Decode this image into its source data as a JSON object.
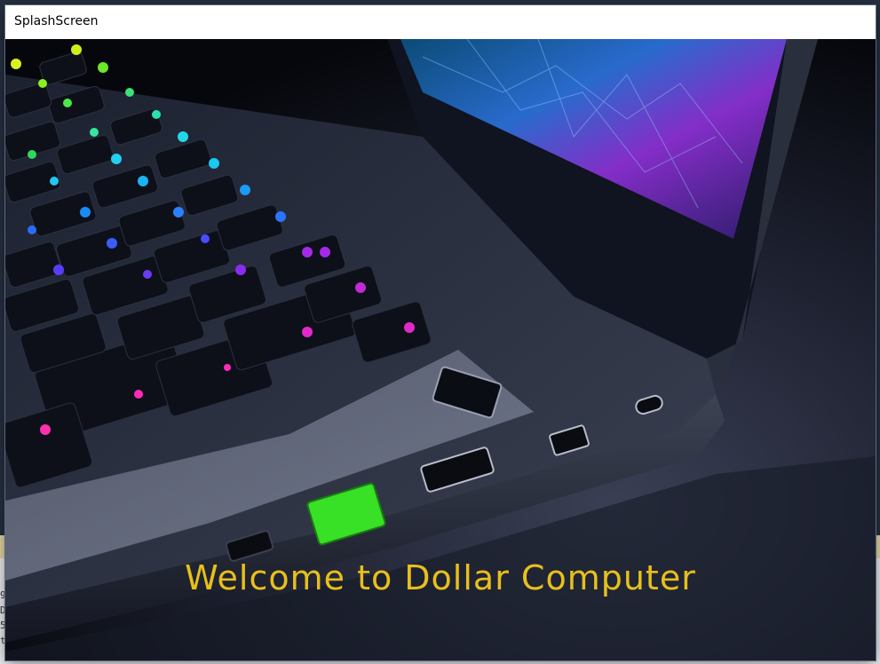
{
  "window": {
    "title": "SplashScreen"
  },
  "splash": {
    "welcome_text": "Welcome to Dollar Computer"
  },
  "background_hint": {
    "lines": [
      "9",
      "D",
      "5",
      "t"
    ]
  },
  "colors": {
    "welcome": "#e8bf1c",
    "backdrop": "#0a0d16",
    "titlebar": "#ffffff"
  }
}
